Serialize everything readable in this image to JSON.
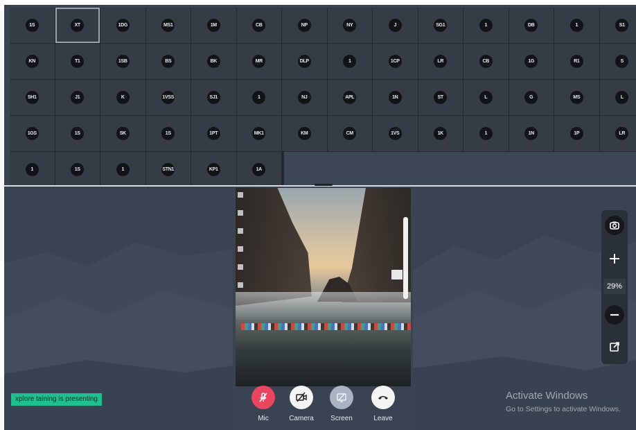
{
  "participants": [
    {
      "initials": "1S"
    },
    {
      "initials": "XT",
      "selected": true
    },
    {
      "initials": "1DG"
    },
    {
      "initials": "MS1"
    },
    {
      "initials": "1M"
    },
    {
      "initials": "CB"
    },
    {
      "initials": "NP"
    },
    {
      "initials": "NY"
    },
    {
      "initials": "J"
    },
    {
      "initials": "SG1"
    },
    {
      "initials": "1"
    },
    {
      "initials": "DB"
    },
    {
      "initials": "1"
    },
    {
      "initials": "S1"
    },
    {
      "initials": "KN"
    },
    {
      "initials": "T1"
    },
    {
      "initials": "1SB"
    },
    {
      "initials": "BS"
    },
    {
      "initials": "BK"
    },
    {
      "initials": "MR"
    },
    {
      "initials": "DLP"
    },
    {
      "initials": "1"
    },
    {
      "initials": "1CP"
    },
    {
      "initials": "LR"
    },
    {
      "initials": "CB"
    },
    {
      "initials": "1G"
    },
    {
      "initials": "R1"
    },
    {
      "initials": "S"
    },
    {
      "initials": "SH1"
    },
    {
      "initials": "J1"
    },
    {
      "initials": "K"
    },
    {
      "initials": "1VSS"
    },
    {
      "initials": "SJ1"
    },
    {
      "initials": "1"
    },
    {
      "initials": "NJ"
    },
    {
      "initials": "APL"
    },
    {
      "initials": "1N"
    },
    {
      "initials": "ST"
    },
    {
      "initials": "L"
    },
    {
      "initials": "G"
    },
    {
      "initials": "MS"
    },
    {
      "initials": "L"
    },
    {
      "initials": "1GS"
    },
    {
      "initials": "1S"
    },
    {
      "initials": "SK"
    },
    {
      "initials": "1S"
    },
    {
      "initials": "1PT"
    },
    {
      "initials": "MK1"
    },
    {
      "initials": "KM"
    },
    {
      "initials": "CM"
    },
    {
      "initials": "1VS"
    },
    {
      "initials": "1K"
    },
    {
      "initials": "1"
    },
    {
      "initials": "1N"
    },
    {
      "initials": "1P"
    },
    {
      "initials": "LR"
    },
    {
      "initials": "1"
    },
    {
      "initials": "1S"
    },
    {
      "initials": "1"
    },
    {
      "initials": "STN1"
    },
    {
      "initials": "KP1"
    },
    {
      "initials": "1A"
    }
  ],
  "zoom": {
    "level": "29%",
    "buttons": [
      "camera-icon",
      "plus-icon",
      "minus-icon",
      "popout-icon"
    ]
  },
  "presenter_banner": "xplore taining is presenting",
  "controls": {
    "mic": {
      "label": "Mic",
      "color": "#e8465f"
    },
    "camera": {
      "label": "Camera",
      "color": "#f4f4f4"
    },
    "screen": {
      "label": "Screen",
      "color": "#a9b3c1"
    },
    "leave": {
      "label": "Leave",
      "color": "#f4f4f4"
    }
  },
  "watermark": {
    "title": "Activate Windows",
    "subtitle": "Go to Settings to activate Windows."
  },
  "colors": {
    "background": "#3a4351",
    "tile": "#363c45",
    "avatar": "#111417",
    "accent_green": "#1fbf8f"
  }
}
